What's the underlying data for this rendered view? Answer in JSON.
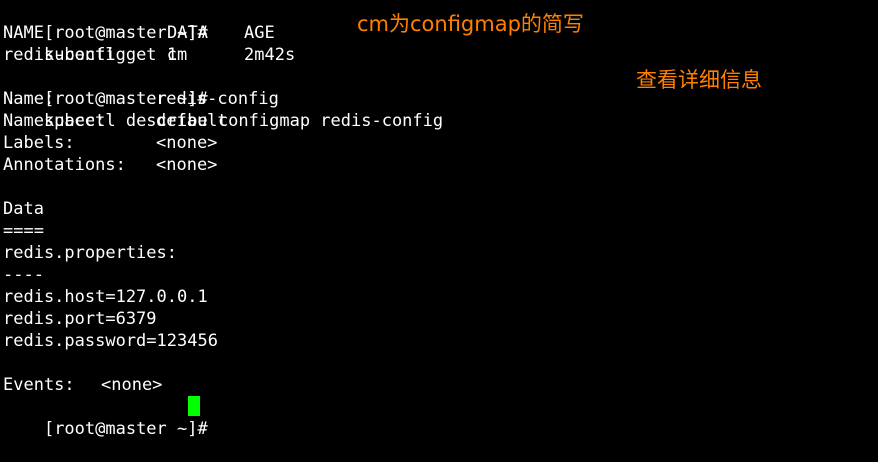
{
  "terminal": {
    "prompt": "[root@master ~]#",
    "cmd1": "kubectl get cm",
    "table": {
      "headers": [
        "NAME",
        "DATA",
        "AGE"
      ],
      "rows": [
        [
          "redis-config",
          "1",
          "2m42s"
        ]
      ]
    },
    "cmd2": "kubectl describe configmap redis-config",
    "describe": {
      "name_label": "Name:",
      "name_value": "redis-config",
      "namespace_label": "Namespace:",
      "namespace_value": "default",
      "labels_label": "Labels:",
      "labels_value": "<none>",
      "annotations_label": "Annotations:",
      "annotations_value": "<none>",
      "data_heading": "Data",
      "data_rule": "====",
      "key": "redis.properties:",
      "key_rule": "----",
      "values": [
        "redis.host=127.0.0.1",
        "redis.port=6379",
        "redis.password=123456"
      ],
      "events_label": "Events:",
      "events_value": "<none>"
    }
  },
  "annotations": {
    "cm_note": "cm为configmap的简写",
    "describe_note": "查看详细信息"
  },
  "colors": {
    "background": "#000000",
    "text": "#ffffff",
    "annotation": "#ff7f00",
    "cursor": "#00ff00"
  }
}
